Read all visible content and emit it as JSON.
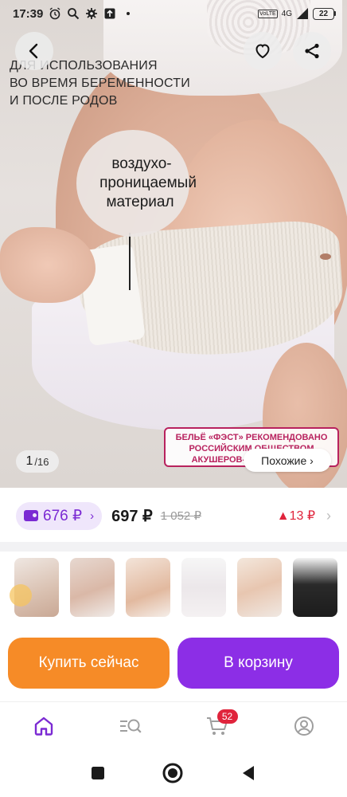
{
  "status_bar": {
    "time": "17:39",
    "icons": [
      "alarm-icon",
      "search-icon",
      "settings-icon",
      "upload-icon",
      "dot-icon"
    ],
    "volte": "VoLTE",
    "network": "4G",
    "battery": "22"
  },
  "gallery": {
    "usage_caption": [
      "ДЛЯ ИСПОЛЬЗОВАНИЯ",
      "ВО ВРЕМЯ БЕРЕМЕННОСТИ",
      "И ПОСЛЕ РОДОВ"
    ],
    "bubble": [
      "воздухо-",
      "проницаемый",
      "материал"
    ],
    "recommendation": [
      "БЕЛЬЁ «ФЭСТ» РЕКОМЕНДОВАНО",
      "РОССИЙСКИМ ОБЩЕСТВОМ",
      "АКУШЕРОВ-ГИНЕКОЛОГОВ"
    ],
    "similar_label": "Похожие ›",
    "current_index": "1",
    "total_images": "/16"
  },
  "price": {
    "wallet_price": "676 ₽",
    "wallet_chevron": "›",
    "price": "697 ₽",
    "old_price": "1 052 ₽",
    "change": "▲13 ₽",
    "row_chevron": "›"
  },
  "thumbnails": [
    "thumb-1",
    "thumb-2",
    "thumb-3",
    "thumb-4",
    "thumb-5",
    "thumb-6"
  ],
  "actions": {
    "buy_now": "Купить сейчас",
    "add_to_cart": "В корзину"
  },
  "bottom_nav": {
    "items": [
      "home-icon",
      "catalog-search-icon",
      "cart-icon",
      "profile-icon"
    ],
    "cart_count": "52"
  },
  "colors": {
    "accent_purple": "#8c2ee6",
    "accent_orange": "#f68b27",
    "price_up_red": "#e0243c",
    "recommend_magenta": "#b8225e"
  }
}
